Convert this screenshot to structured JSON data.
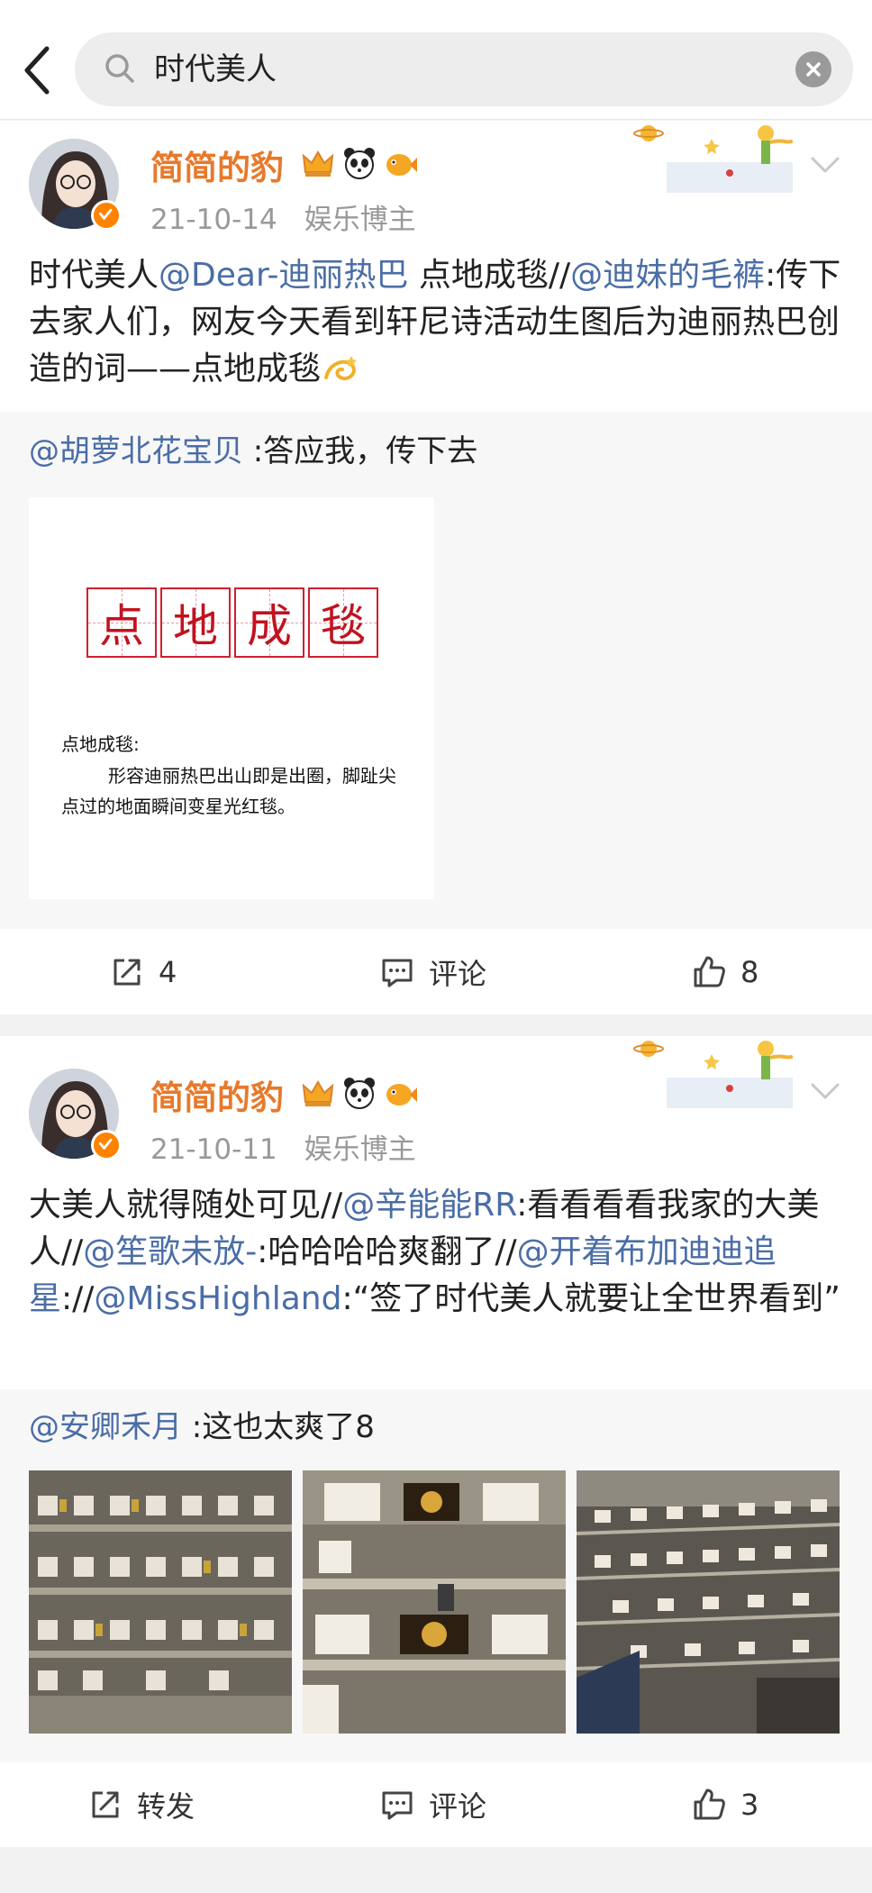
{
  "search": {
    "query": "时代美人"
  },
  "colors": {
    "accent": "#e7792b",
    "mention": "#4a6da7",
    "badge": "#ff8200"
  },
  "posts": [
    {
      "username": "简简的豹",
      "date": "21-10-14",
      "tag": "娱乐博主",
      "badge_icons": [
        "crown-icon",
        "panda-icon",
        "fish-icon"
      ],
      "text": {
        "p1": "时代美人",
        "m1": "@Dear-迪丽热巴",
        "p2": " 点地成毯//",
        "m2": "@迪妹的毛裤",
        "p3": ":传下去家人们，网友今天看到轩尼诗活动生图后为迪丽热巴创造的词——点地成毯",
        "emoji": "dizzy-emoji"
      },
      "repost": {
        "mention": "@胡萝北花宝贝",
        "text": " :答应我，传下去",
        "card": {
          "chars": [
            "点",
            "地",
            "成",
            "毯"
          ],
          "def_title": "点地成毯:",
          "def_body": "形容迪丽热巴出山即是出圈，脚趾尖点过的地面瞬间变星光红毯。"
        }
      },
      "actions": {
        "share": "4",
        "comment": "评论",
        "like": "8"
      }
    },
    {
      "username": "简简的豹",
      "date": "21-10-11",
      "tag": "娱乐博主",
      "badge_icons": [
        "crown-icon",
        "panda-icon",
        "fish-icon"
      ],
      "text": {
        "p1": "大美人就得随处可见//",
        "m1": "@辛能能RR",
        "p2": ":看看看看我家的大美人//",
        "m2": "@笙歌未放-",
        "p3": ":哈哈哈哈爽翻了//",
        "m3": "@开着布加迪迪追星",
        "p4": "://",
        "m4": "@MissHighland",
        "p5": ":“签了时代美人就要让全世界看到”"
      },
      "repost": {
        "mention": "@安卿禾月",
        "text": " :这也太爽了8"
      },
      "actions": {
        "share": "转发",
        "comment": "评论",
        "like": "3"
      }
    }
  ]
}
